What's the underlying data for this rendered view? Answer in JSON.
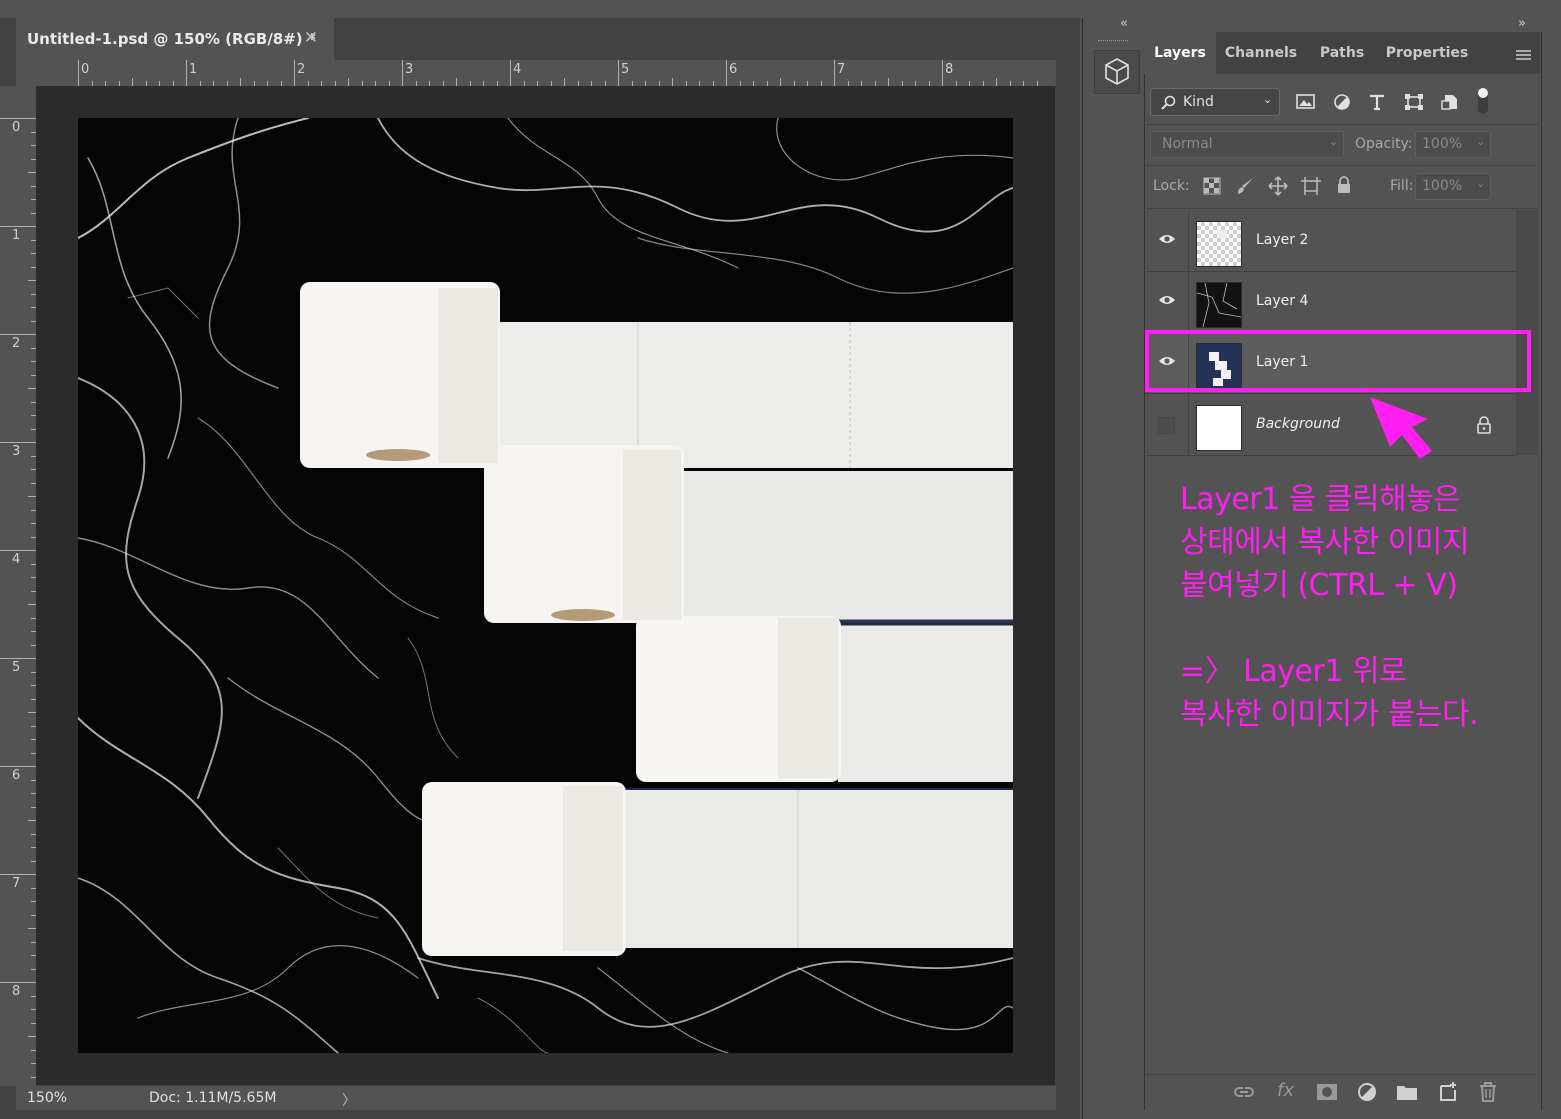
{
  "document": {
    "tab_title": "Untitled-1.psd @ 150% (RGB/8#) *",
    "close_glyph": "✕",
    "ruler_h_numbers": [
      "0",
      "1",
      "2",
      "3",
      "4",
      "5",
      "6",
      "7",
      "8"
    ],
    "ruler_v_numbers": [
      "0",
      "1",
      "2",
      "3",
      "4",
      "5",
      "6",
      "7",
      "8"
    ]
  },
  "status": {
    "zoom": "150%",
    "doc_info": "Doc: 1.11M/5.65M",
    "arrow": "〉"
  },
  "dock": {
    "collapse_left": "«",
    "collapse_right": "»",
    "icon": "3d-cube-icon"
  },
  "panel": {
    "tabs": [
      "Layers",
      "Channels",
      "Paths",
      "Properties"
    ],
    "active_tab": "Layers",
    "filter": {
      "kind_label": "Kind"
    },
    "blend_mode": "Normal",
    "opacity_label": "Opacity:",
    "opacity_value": "100%",
    "lock_label": "Lock:",
    "fill_label": "Fill:",
    "fill_value": "100%",
    "layers": [
      {
        "name": "Layer 2",
        "visible": true,
        "thumb": "pattern"
      },
      {
        "name": "Layer 4",
        "visible": true,
        "thumb": "marble"
      },
      {
        "name": "Layer 1",
        "visible": true,
        "thumb": "rolls",
        "highlighted": true
      },
      {
        "name": "Background",
        "visible": false,
        "thumb": "white",
        "locked": true
      }
    ]
  },
  "annotation": {
    "line1": "Layer1 을 클릭해놓은",
    "line2": "상태에서 복사한 이미지",
    "line3": "붙여넣기 (CTRL + V)",
    "line4": "=〉 Layer1 위로",
    "line5": "복사한 이미지가 붙는다.",
    "color": "#ff1ff0"
  }
}
